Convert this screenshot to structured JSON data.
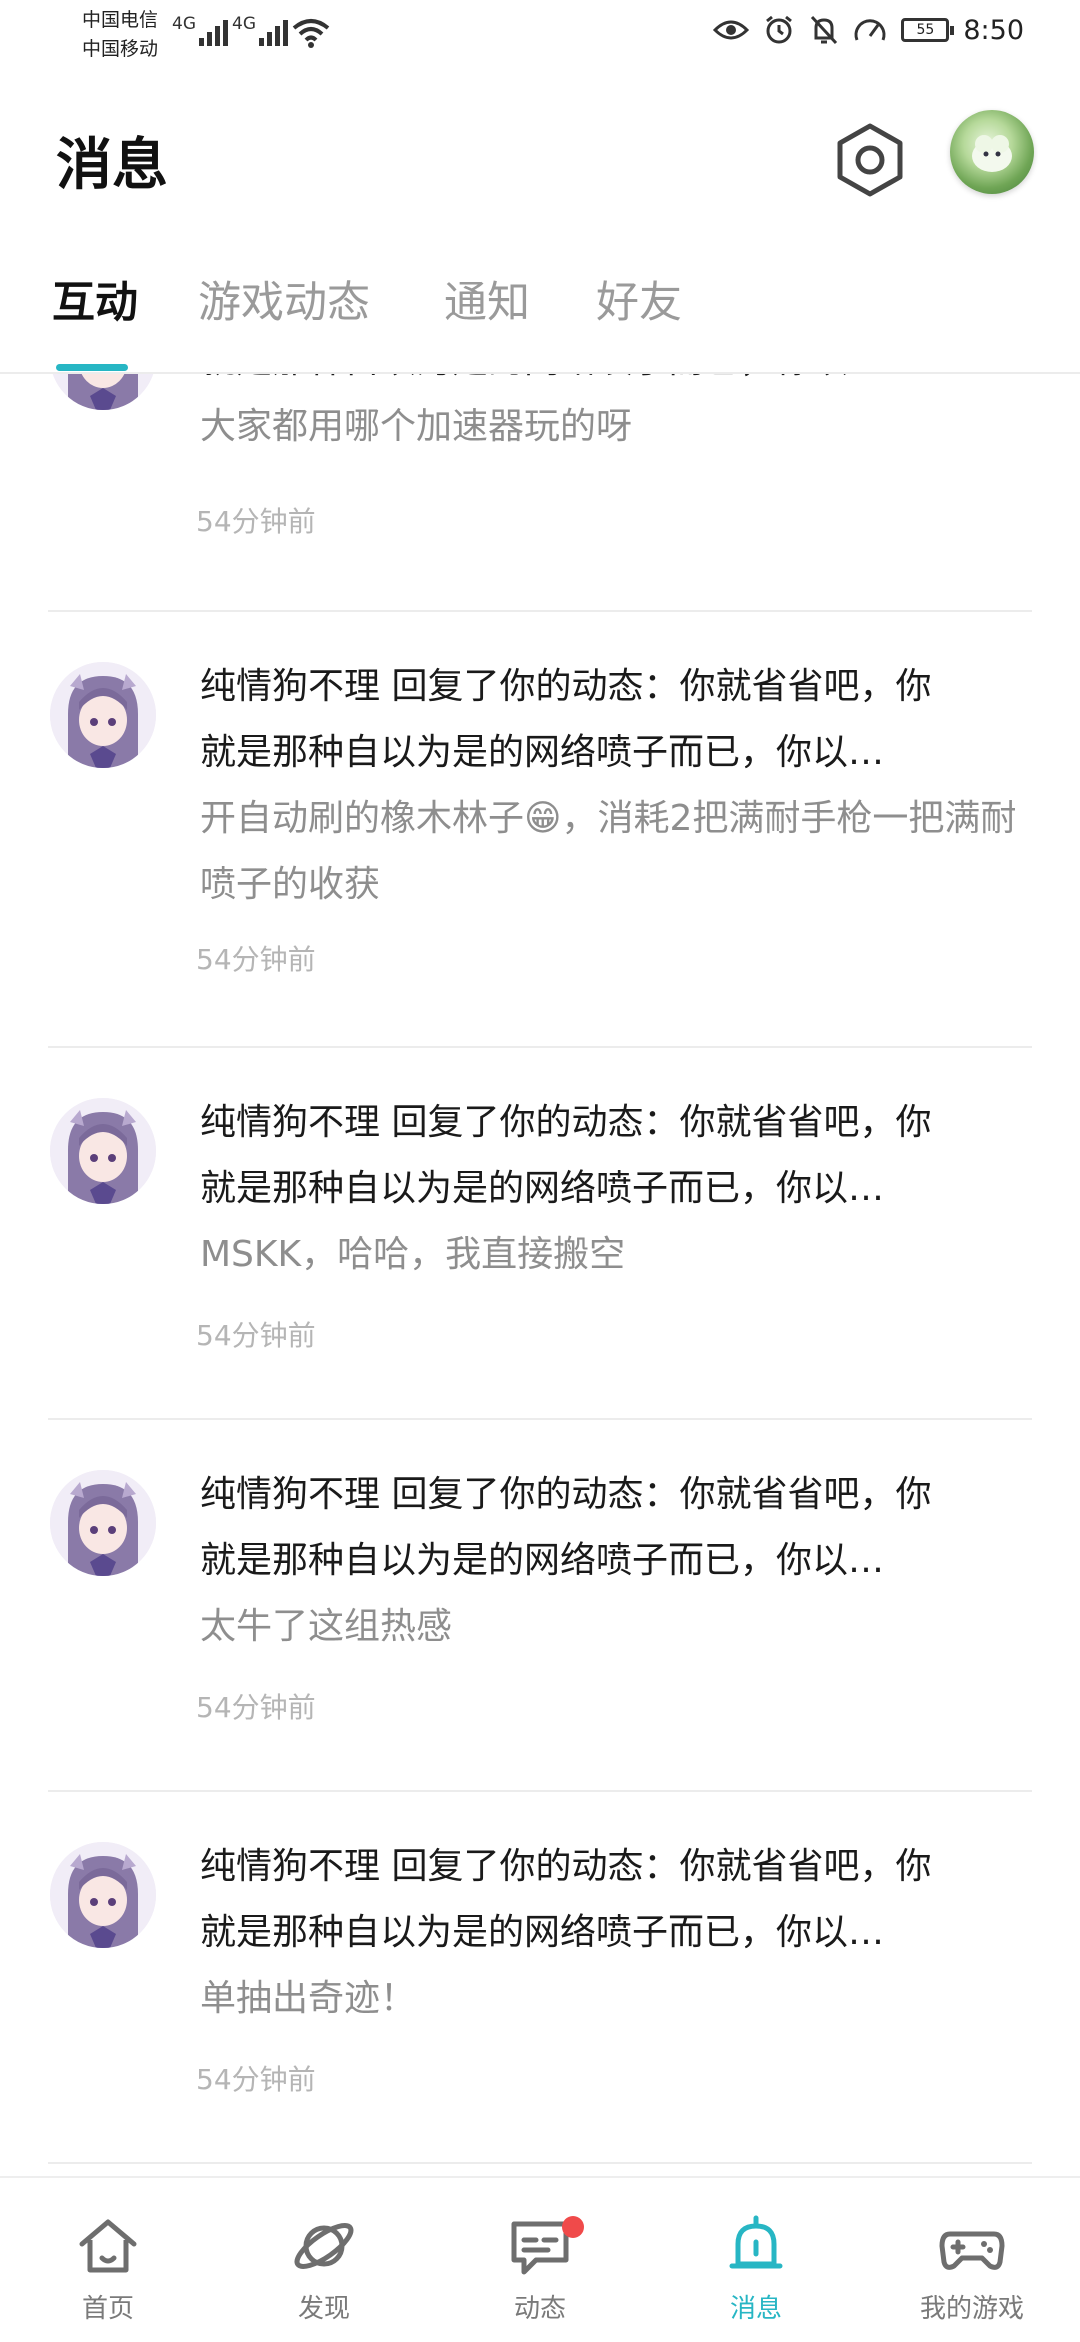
{
  "status_bar": {
    "carrier_1": "中国电信",
    "carrier_2": "中国移动",
    "network_1": "4G",
    "network_2": "4G",
    "battery": "55",
    "time": "8:50"
  },
  "header": {
    "title": "消息"
  },
  "tabs": [
    {
      "label": "互动",
      "active": true
    },
    {
      "label": "游戏动态",
      "active": false
    },
    {
      "label": "通知",
      "active": false
    },
    {
      "label": "好友",
      "active": false
    }
  ],
  "messages": [
    {
      "line1": "",
      "line2": "就是那种自以为是的网络喷子而已，你以…",
      "reply": "大家都用哪个加速器玩的呀",
      "time": "54分钟前"
    },
    {
      "line1": "纯情狗不理 回复了你的动态：你就省省吧，你",
      "line2": "就是那种自以为是的网络喷子而已，你以…",
      "reply": "开自动刷的橡木林子😁，消耗2把满耐手枪一把满耐喷子的收获",
      "time": "54分钟前"
    },
    {
      "line1": "纯情狗不理 回复了你的动态：你就省省吧，你",
      "line2": "就是那种自以为是的网络喷子而已，你以…",
      "reply": "MSKK，哈哈，我直接搬空",
      "time": "54分钟前"
    },
    {
      "line1": "纯情狗不理 回复了你的动态：你就省省吧，你",
      "line2": "就是那种自以为是的网络喷子而已，你以…",
      "reply": "太牛了这组热感",
      "time": "54分钟前"
    },
    {
      "line1": "纯情狗不理 回复了你的动态：你就省省吧，你",
      "line2": "就是那种自以为是的网络喷子而已，你以…",
      "reply": "单抽出奇迹！",
      "time": "54分钟前"
    }
  ],
  "bottom_nav": [
    {
      "label": "首页",
      "icon": "home-icon"
    },
    {
      "label": "发现",
      "icon": "planet-icon"
    },
    {
      "label": "动态",
      "icon": "chat-icon",
      "badge": true
    },
    {
      "label": "消息",
      "icon": "bell-icon",
      "active": true
    },
    {
      "label": "我的游戏",
      "icon": "gamepad-icon"
    }
  ],
  "colors": {
    "accent": "#27b6c4",
    "badge": "#f04a4a"
  }
}
